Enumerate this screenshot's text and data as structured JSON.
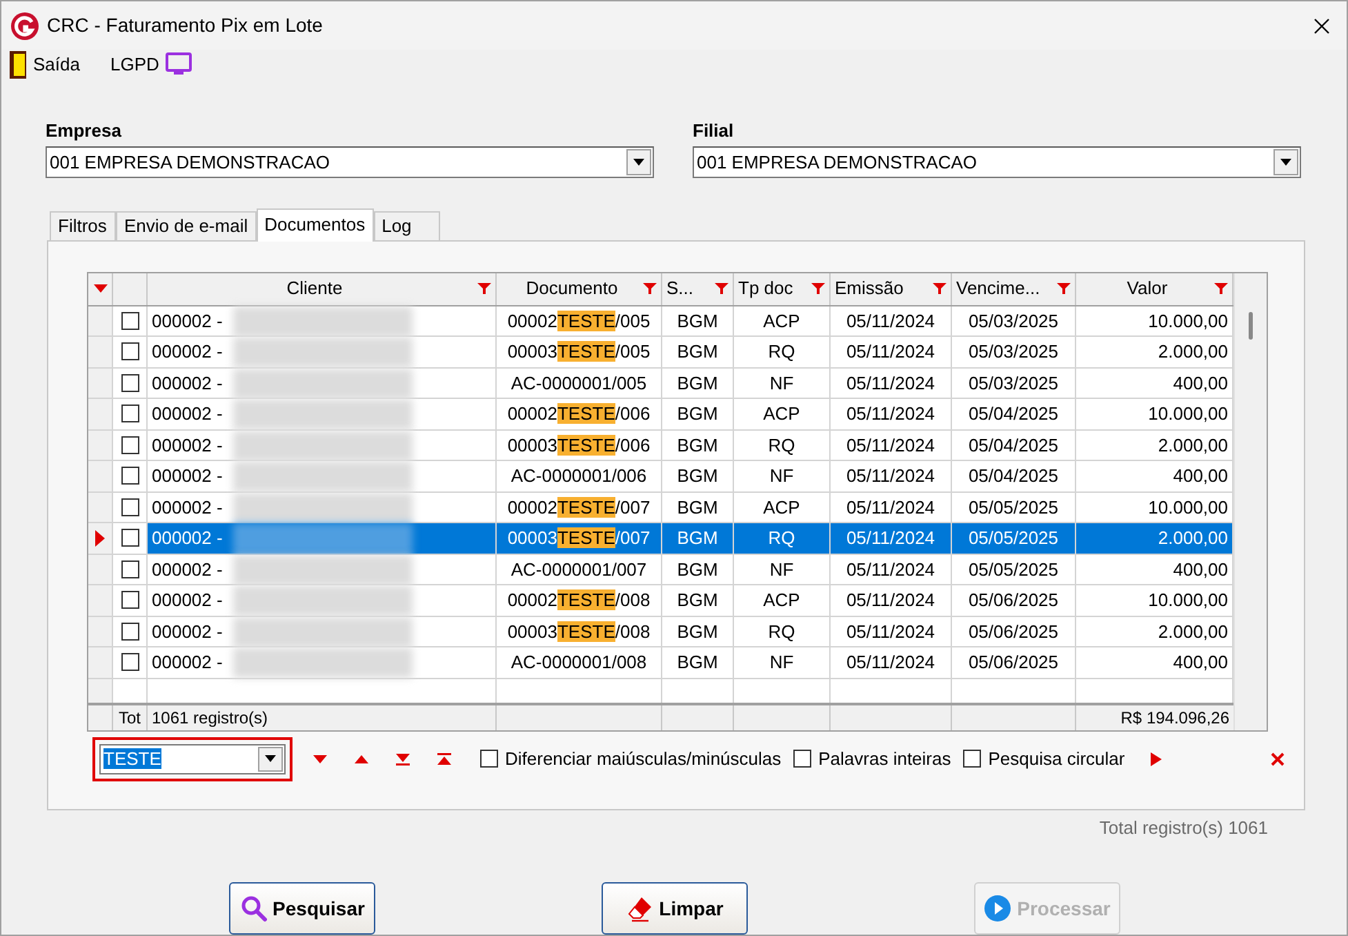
{
  "window": {
    "title": "CRC - Faturamento Pix em Lote"
  },
  "toolbar": [
    {
      "label": "Saída",
      "kind": "exit"
    },
    {
      "label": "LGPD",
      "kind": "lgpd"
    }
  ],
  "empresa": {
    "label": "Empresa",
    "value": "001 EMPRESA DEMONSTRACAO"
  },
  "filial": {
    "label": "Filial",
    "value": "001 EMPRESA DEMONSTRACAO"
  },
  "tabs": [
    {
      "label": "Filtros",
      "selected": false
    },
    {
      "label": "Envio de e-mail",
      "selected": false
    },
    {
      "label": "Documentos",
      "selected": true
    },
    {
      "label": "Log",
      "selected": false
    }
  ],
  "grid": {
    "columns": [
      {
        "label": "Cliente"
      },
      {
        "label": "Documento"
      },
      {
        "label": "S..."
      },
      {
        "label": "Tp doc"
      },
      {
        "label": "Emissão"
      },
      {
        "label": "Vencime..."
      },
      {
        "label": "Valor"
      }
    ],
    "rows": [
      {
        "selected": false,
        "checked": false,
        "client": "000002 -",
        "document": {
          "before": "00002",
          "match": "TESTE",
          "after": "/005"
        },
        "serie": "BGM",
        "tp_doc": "ACP",
        "emissao": "05/11/2024",
        "vencimento": "05/03/2025",
        "valor": "10.000,00"
      },
      {
        "selected": false,
        "checked": false,
        "client": "000002 -",
        "document": {
          "before": "00003",
          "match": "TESTE",
          "after": "/005"
        },
        "serie": "BGM",
        "tp_doc": "RQ",
        "emissao": "05/11/2024",
        "vencimento": "05/03/2025",
        "valor": "2.000,00"
      },
      {
        "selected": false,
        "checked": false,
        "client": "000002 -",
        "document": {
          "before": "AC-0000001/005"
        },
        "serie": "BGM",
        "tp_doc": "NF",
        "emissao": "05/11/2024",
        "vencimento": "05/03/2025",
        "valor": "400,00"
      },
      {
        "selected": false,
        "checked": false,
        "client": "000002 -",
        "document": {
          "before": "00002",
          "match": "TESTE",
          "after": "/006"
        },
        "serie": "BGM",
        "tp_doc": "ACP",
        "emissao": "05/11/2024",
        "vencimento": "05/04/2025",
        "valor": "10.000,00"
      },
      {
        "selected": false,
        "checked": false,
        "client": "000002 -",
        "document": {
          "before": "00003",
          "match": "TESTE",
          "after": "/006"
        },
        "serie": "BGM",
        "tp_doc": "RQ",
        "emissao": "05/11/2024",
        "vencimento": "05/04/2025",
        "valor": "2.000,00"
      },
      {
        "selected": false,
        "checked": false,
        "client": "000002 -",
        "document": {
          "before": "AC-0000001/006"
        },
        "serie": "BGM",
        "tp_doc": "NF",
        "emissao": "05/11/2024",
        "vencimento": "05/04/2025",
        "valor": "400,00"
      },
      {
        "selected": false,
        "checked": false,
        "client": "000002 -",
        "document": {
          "before": "00002",
          "match": "TESTE",
          "after": "/007"
        },
        "serie": "BGM",
        "tp_doc": "ACP",
        "emissao": "05/11/2024",
        "vencimento": "05/05/2025",
        "valor": "10.000,00"
      },
      {
        "selected": true,
        "checked": false,
        "client": "000002 -",
        "document": {
          "before": "00003",
          "match": "TESTE",
          "after": "/007"
        },
        "serie": "BGM",
        "tp_doc": "RQ",
        "emissao": "05/11/2024",
        "vencimento": "05/05/2025",
        "valor": "2.000,00"
      },
      {
        "selected": false,
        "checked": false,
        "client": "000002 -",
        "document": {
          "before": "AC-0000001/007"
        },
        "serie": "BGM",
        "tp_doc": "NF",
        "emissao": "05/11/2024",
        "vencimento": "05/05/2025",
        "valor": "400,00"
      },
      {
        "selected": false,
        "checked": false,
        "client": "000002 -",
        "document": {
          "before": "00002",
          "match": "TESTE",
          "after": "/008"
        },
        "serie": "BGM",
        "tp_doc": "ACP",
        "emissao": "05/11/2024",
        "vencimento": "05/06/2025",
        "valor": "10.000,00"
      },
      {
        "selected": false,
        "checked": false,
        "client": "000002 -",
        "document": {
          "before": "00003",
          "match": "TESTE",
          "after": "/008"
        },
        "serie": "BGM",
        "tp_doc": "RQ",
        "emissao": "05/11/2024",
        "vencimento": "05/06/2025",
        "valor": "2.000,00"
      },
      {
        "selected": false,
        "checked": false,
        "client": "000002 -",
        "document": {
          "before": "AC-0000001/008"
        },
        "serie": "BGM",
        "tp_doc": "NF",
        "emissao": "05/11/2024",
        "vencimento": "05/06/2025",
        "valor": "400,00"
      }
    ],
    "footer": {
      "label": "Tot",
      "count": "1061 registro(s)",
      "total": "R$ 194.096,26"
    }
  },
  "search": {
    "value": "TESTE",
    "options": [
      {
        "label": "Diferenciar maiúsculas/minúsculas",
        "checked": false
      },
      {
        "label": "Palavras inteiras",
        "checked": false
      },
      {
        "label": "Pesquisa circular",
        "checked": false
      }
    ]
  },
  "total": "Total registro(s) 1061",
  "buttons": [
    {
      "label": "Pesquisar",
      "kind": "search",
      "disabled": false
    },
    {
      "label": "Limpar",
      "kind": "clear",
      "disabled": false
    },
    {
      "label": "Processar",
      "kind": "process",
      "disabled": true
    }
  ]
}
